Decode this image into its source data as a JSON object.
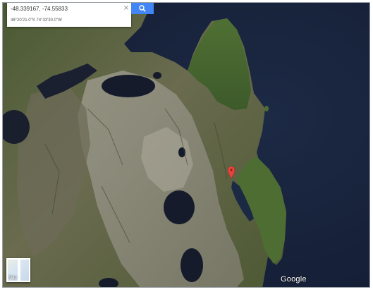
{
  "search": {
    "query": "-48.339167, -74.55833",
    "clear_glyph": "×",
    "button_icon": "search-icon"
  },
  "coordinates_dms": "48°20'21.0\"S 74°33'30.0\"W",
  "map": {
    "view": "satellite",
    "marker_icon": "location-pin-icon",
    "marker_color": "#e8453c",
    "water_color": "#17223c",
    "land_color": "#57603c"
  },
  "controls": {
    "map_type_label": "Map"
  },
  "branding": {
    "logo_text": "Google"
  }
}
